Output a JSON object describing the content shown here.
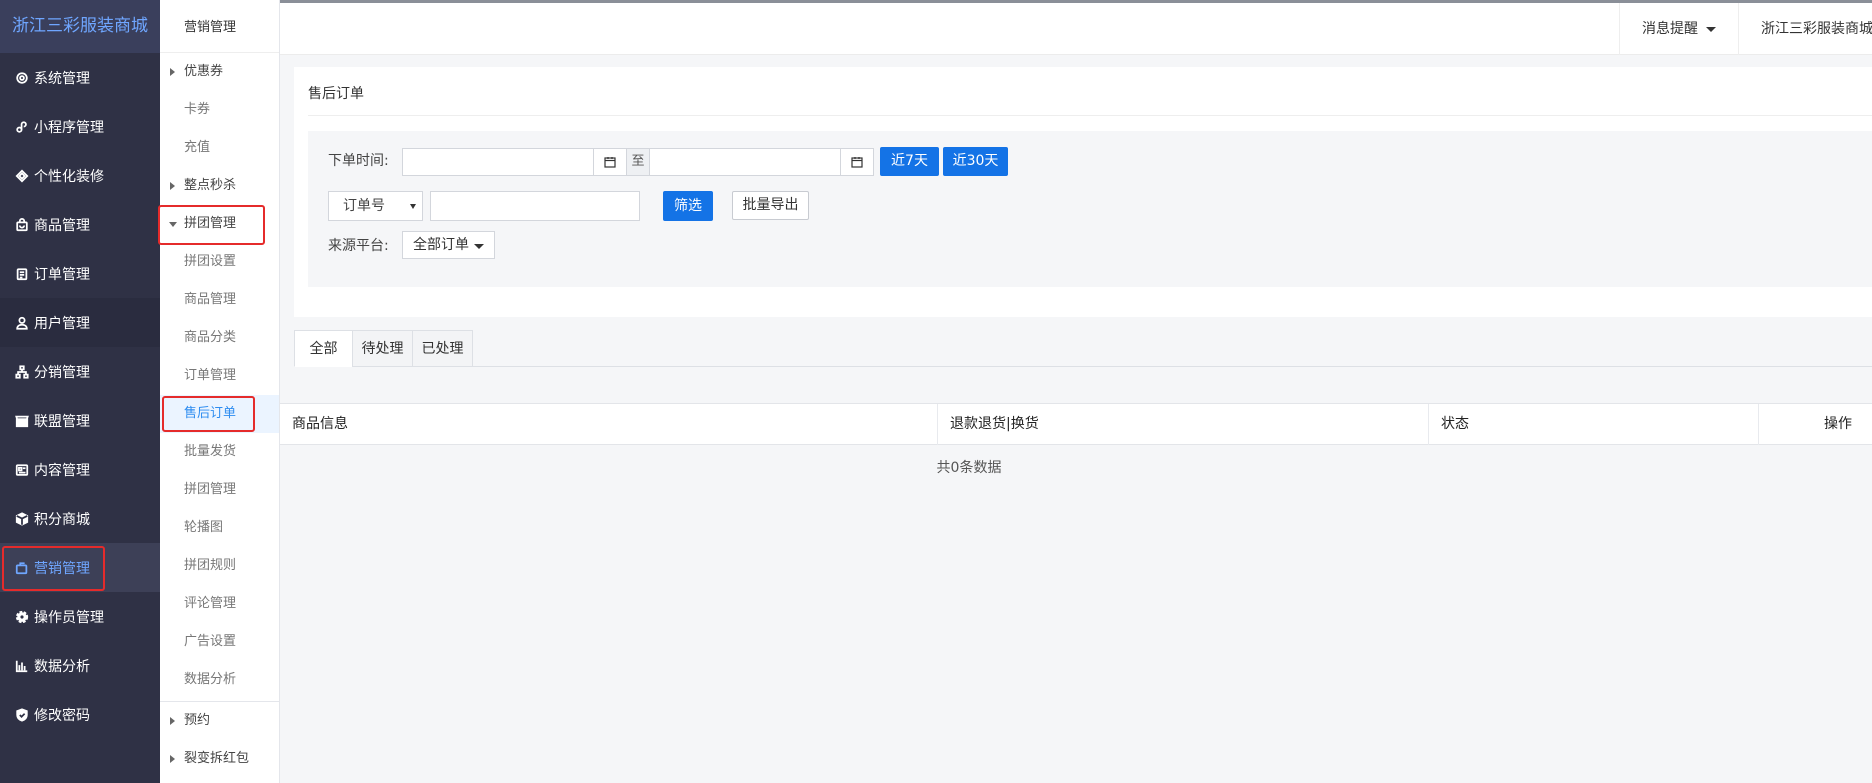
{
  "brand": "浙江三彩服装商城",
  "nav": [
    {
      "label": "系统管理",
      "icon": "gear-outline-icon"
    },
    {
      "label": "小程序管理",
      "icon": "mini-program-icon"
    },
    {
      "label": "个性化装修",
      "icon": "decoration-icon"
    },
    {
      "label": "商品管理",
      "icon": "bag-icon"
    },
    {
      "label": "订单管理",
      "icon": "clipboard-icon"
    },
    {
      "label": "用户管理",
      "icon": "user-icon"
    },
    {
      "label": "分销管理",
      "icon": "org-chart-icon"
    },
    {
      "label": "联盟管理",
      "icon": "store-icon"
    },
    {
      "label": "内容管理",
      "icon": "content-icon"
    },
    {
      "label": "积分商城",
      "icon": "cube-icon"
    },
    {
      "label": "营销管理",
      "icon": "marketing-icon"
    },
    {
      "label": "操作员管理",
      "icon": "gear-solid-icon"
    },
    {
      "label": "数据分析",
      "icon": "bar-chart-icon"
    },
    {
      "label": "修改密码",
      "icon": "shield-check-icon"
    }
  ],
  "subnav": {
    "title": "营销管理",
    "items": [
      {
        "label": "优惠券",
        "type": "group"
      },
      {
        "label": "卡券",
        "type": "child"
      },
      {
        "label": "充值",
        "type": "child"
      },
      {
        "label": "整点秒杀",
        "type": "group"
      },
      {
        "label": "拼团管理",
        "type": "group-open"
      },
      {
        "label": "拼团设置",
        "type": "child"
      },
      {
        "label": "商品管理",
        "type": "child"
      },
      {
        "label": "商品分类",
        "type": "child"
      },
      {
        "label": "订单管理",
        "type": "child"
      },
      {
        "label": "售后订单",
        "type": "selected"
      },
      {
        "label": "批量发货",
        "type": "child"
      },
      {
        "label": "拼团管理",
        "type": "child"
      },
      {
        "label": "轮播图",
        "type": "child"
      },
      {
        "label": "拼团规则",
        "type": "child"
      },
      {
        "label": "评论管理",
        "type": "child"
      },
      {
        "label": "广告设置",
        "type": "child"
      },
      {
        "label": "数据分析",
        "type": "child"
      }
    ],
    "bottom": [
      {
        "label": "预约"
      },
      {
        "label": "裂变拆红包"
      }
    ]
  },
  "header": {
    "notifications": "消息提醒",
    "store": "浙江三彩服装商城"
  },
  "page": {
    "title": "售后订单",
    "filters": {
      "order_time_label": "下单时间:",
      "to_label": "至",
      "start_date": "",
      "end_date": "",
      "last7": "近7天",
      "last30": "近30天",
      "field_select": "订单号",
      "keyword": "",
      "filter_btn": "筛选",
      "export_btn": "批量导出",
      "source_label": "来源平台:",
      "source_value": "全部订单"
    },
    "tabs": [
      "全部",
      "待处理",
      "已处理"
    ],
    "active_tab": "全部",
    "table": {
      "columns": [
        "商品信息",
        "退款退货|换货",
        "状态",
        "操作"
      ],
      "empty": "共0条数据"
    }
  }
}
